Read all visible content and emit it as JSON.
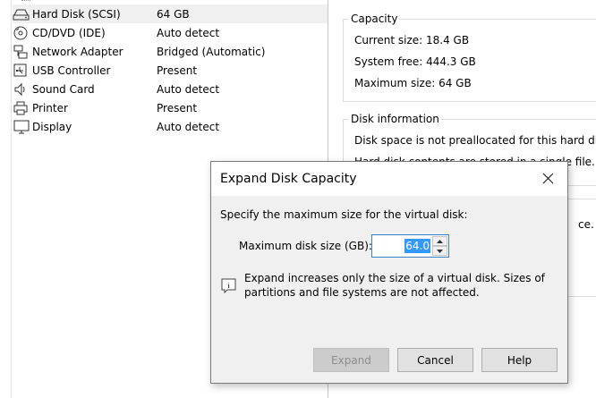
{
  "devices": [
    {
      "name": "Hard Disk (SCSI)",
      "summary": "64 GB",
      "icon": "hard-disk-icon",
      "selected": true
    },
    {
      "name": "CD/DVD (IDE)",
      "summary": "Auto detect",
      "icon": "cd-dvd-icon"
    },
    {
      "name": "Network Adapter",
      "summary": "Bridged (Automatic)",
      "icon": "network-adapter-icon"
    },
    {
      "name": "USB Controller",
      "summary": "Present",
      "icon": "usb-controller-icon"
    },
    {
      "name": "Sound Card",
      "summary": "Auto detect",
      "icon": "sound-card-icon"
    },
    {
      "name": "Printer",
      "summary": "Present",
      "icon": "printer-icon"
    },
    {
      "name": "Display",
      "summary": "Auto detect",
      "icon": "display-icon"
    }
  ],
  "capacity": {
    "title": "Capacity",
    "current_size": "Current size: 18.4 GB",
    "system_free": "System free: 444.3 GB",
    "maximum_size": "Maximum size: 64 GB"
  },
  "disk_information": {
    "title": "Disk information",
    "line1": "Disk space is not preallocated for this hard disk",
    "line2": "Hard disk contents are stored in a single file.",
    "line3_fragment": "ce."
  },
  "dialog": {
    "title": "Expand Disk Capacity",
    "prompt": "Specify the maximum size for the virtual disk:",
    "field_label": "Maximum disk size (GB):",
    "field_value": "64.0",
    "info_line1": "Expand increases only the size of a virtual disk. Sizes of",
    "info_line2": "partitions and file systems are not affected.",
    "expand_label": "Expand",
    "cancel_label": "Cancel",
    "help_label": "Help"
  },
  "colors": {
    "selection_highlight": "#3399ff",
    "input_border": "#3c7fc8",
    "dialog_background": "#f0f0f0"
  }
}
